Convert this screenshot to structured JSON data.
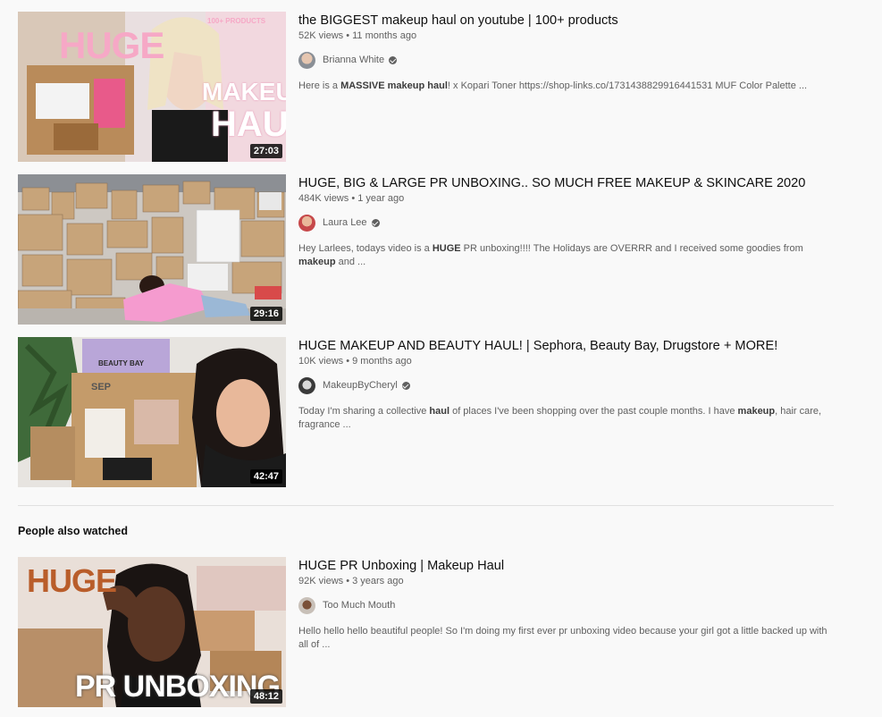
{
  "videos": [
    {
      "title": "the BIGGEST makeup haul on youtube | 100+ products",
      "views": "52K views",
      "age": "11 months ago",
      "channel": "Brianna White",
      "verified": true,
      "snippet": [
        {
          "t": "Here is a "
        },
        {
          "t": "MASSIVE",
          "b": true
        },
        {
          "t": " "
        },
        {
          "t": "makeup",
          "b": true
        },
        {
          "t": " "
        },
        {
          "t": "haul",
          "b": true
        },
        {
          "t": "! x Kopari Toner https://shop-links.co/1731438829916441531 MUF Color Palette ..."
        }
      ],
      "duration": "27:03",
      "thumb_text": {
        "huge": "HUGE",
        "makeup": "MAKEUP",
        "haul": "HAUL",
        "badge": "100+ PRODUCTS"
      }
    },
    {
      "title": "HUGE, BIG & LARGE PR UNBOXING.. SO MUCH FREE MAKEUP & SKINCARE 2020",
      "views": "484K views",
      "age": "1 year ago",
      "channel": "Laura Lee",
      "verified": true,
      "snippet": [
        {
          "t": "Hey Larlees, todays video is a "
        },
        {
          "t": "HUGE",
          "b": true
        },
        {
          "t": " PR unboxing!!!! The Holidays are OVERRR and I received some goodies from "
        },
        {
          "t": "makeup",
          "b": true
        },
        {
          "t": " and ..."
        }
      ],
      "duration": "29:16"
    },
    {
      "title": "HUGE MAKEUP AND BEAUTY HAUL! | Sephora, Beauty Bay, Drugstore + MORE!",
      "views": "10K views",
      "age": "9 months ago",
      "channel": "MakeupByCheryl",
      "verified": true,
      "snippet": [
        {
          "t": "Today I'm sharing a collective "
        },
        {
          "t": "haul",
          "b": true
        },
        {
          "t": " of places I've been shopping over the past couple months. I have "
        },
        {
          "t": "makeup",
          "b": true
        },
        {
          "t": ", hair care, fragrance ..."
        }
      ],
      "duration": "42:47",
      "thumb_text": {
        "box": "BEAUTY BAY",
        "sep": "SEP"
      }
    }
  ],
  "shelf": {
    "title": "People also watched",
    "videos": [
      {
        "title": "HUGE PR Unboxing | Makeup Haul",
        "views": "92K views",
        "age": "3 years ago",
        "channel": "Too Much Mouth",
        "verified": false,
        "snippet": [
          {
            "t": "Hello hello hello beautiful people! So I'm doing my first ever pr unboxing video because your girl got a little backed up with all of ..."
          }
        ],
        "duration": "48:12",
        "thumb_text": {
          "huge": "HUGE",
          "pr": "PR UNBOXING"
        }
      }
    ]
  },
  "colors": {
    "background": "#f9f9f9",
    "text_primary": "#0f0f0f",
    "text_secondary": "#606060",
    "thumb_pink": "#f4a9c8"
  }
}
